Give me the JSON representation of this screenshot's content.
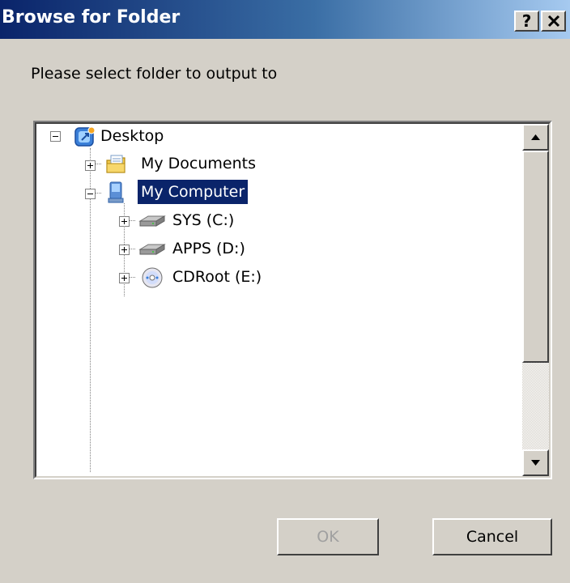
{
  "window": {
    "title": "Browse for Folder",
    "help_label": "?",
    "close_label": "✕"
  },
  "prompt": "Please select folder to output to",
  "tree": {
    "desktop": "Desktop",
    "my_documents": "My Documents",
    "my_computer": "My Computer",
    "drive_c": "SYS (C:)",
    "drive_d": "APPS (D:)",
    "drive_e": "CDRoot (E:)"
  },
  "buttons": {
    "ok": "OK",
    "cancel": "Cancel"
  },
  "colors": {
    "selection": "#0a246a",
    "titlebar_start": "#0a246a",
    "face": "#d4d0c8"
  }
}
